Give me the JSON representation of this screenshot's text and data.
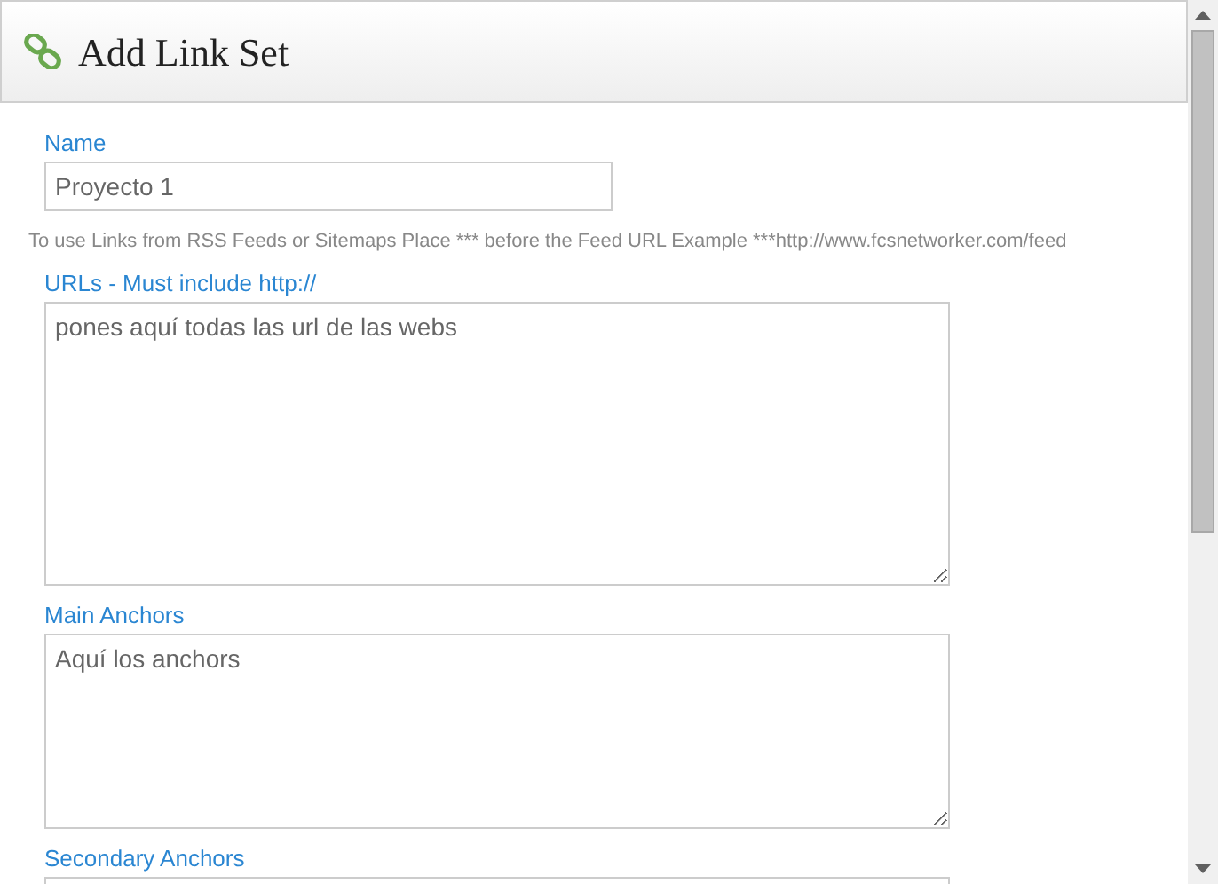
{
  "header": {
    "title": "Add Link Set"
  },
  "fields": [
    {
      "kind": "input",
      "label": "Name",
      "value": "Proyecto 1"
    },
    {
      "kind": "note",
      "text": "To use Links from RSS Feeds or Sitemaps Place *** before the Feed URL Example ***http://www.fcsnetworker.com/feed"
    },
    {
      "kind": "textarea",
      "label": "URLs - Must include http://",
      "value": "pones aquí todas las url de las webs"
    },
    {
      "kind": "textarea",
      "label": "Main Anchors",
      "value": "Aquí los anchors"
    },
    {
      "kind": "textarea",
      "label": "Secondary Anchors"
    }
  ]
}
